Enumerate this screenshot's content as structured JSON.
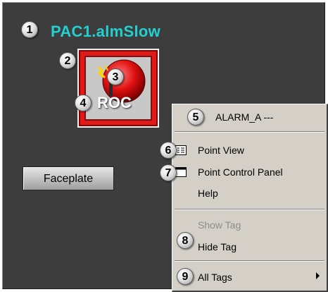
{
  "title": "PAC1.almSlow",
  "icon_label": "ROC",
  "faceplate_button": "Faceplate",
  "callouts": [
    "1",
    "2",
    "3",
    "4",
    "5",
    "6",
    "7",
    "8",
    "9"
  ],
  "menu": {
    "header": "ALARM_A ---",
    "point_view": "Point View",
    "point_control_panel": "Point Control Panel",
    "help": "Help",
    "show_tag": "Show Tag",
    "hide_tag": "Hide Tag",
    "all_tags": "All Tags"
  },
  "colors": {
    "background": "#3d3d3d",
    "title": "#23d0cf",
    "icon_frame": "#e01919",
    "menu_bg": "#d4d0c8",
    "disabled_text": "#8d8d8d"
  },
  "icons": [
    "alarm-bell-icon",
    "point-view-icon",
    "point-control-panel-icon",
    "submenu-arrow-icon"
  ]
}
